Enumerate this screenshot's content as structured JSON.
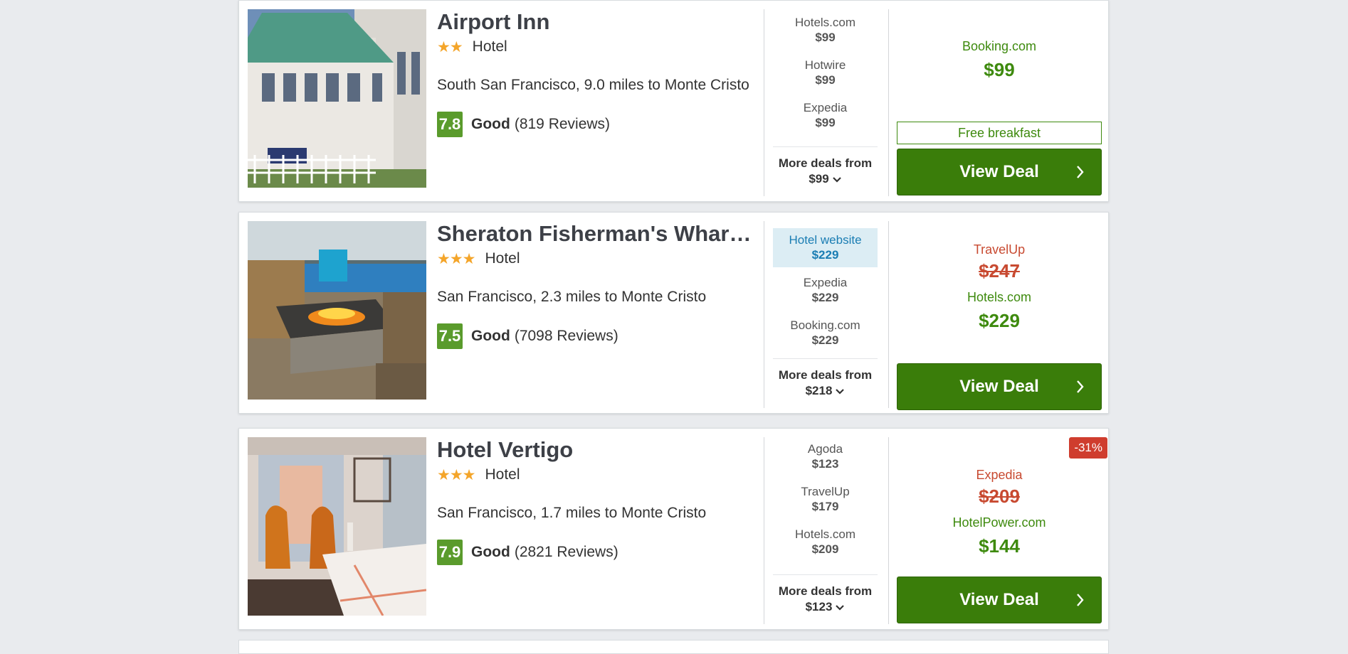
{
  "results": [
    {
      "name": "Airport Inn",
      "stars": "★★",
      "type": "Hotel",
      "location": "South San Francisco, 9.0 miles to Monte Cristo",
      "score": "7.8",
      "rating_word": "Good",
      "reviews": "(819 Reviews)",
      "deals": [
        {
          "provider": "Hotels.com",
          "price": "$99"
        },
        {
          "provider": "Hotwire",
          "price": "$99"
        },
        {
          "provider": "Expedia",
          "price": "$99"
        }
      ],
      "more_label": "More deals from",
      "more_price": "$99",
      "main_provider": "Booking.com",
      "main_price": "$99",
      "perk": "Free breakfast",
      "button": "View Deal"
    },
    {
      "name": "Sheraton Fisherman's Wharf …",
      "stars": "★★★",
      "type": "Hotel",
      "location": "San Francisco, 2.3 miles to Monte Cristo",
      "score": "7.5",
      "rating_word": "Good",
      "reviews": "(7098 Reviews)",
      "deals": [
        {
          "provider": "Hotel website",
          "price": "$229",
          "highlight": true
        },
        {
          "provider": "Expedia",
          "price": "$229"
        },
        {
          "provider": "Booking.com",
          "price": "$229"
        }
      ],
      "more_label": "More deals from",
      "more_price": "$218",
      "old_provider": "TravelUp",
      "old_price": "$247",
      "main_provider": "Hotels.com",
      "main_price": "$229",
      "button": "View Deal"
    },
    {
      "name": "Hotel Vertigo",
      "stars": "★★★",
      "type": "Hotel",
      "location": "San Francisco, 1.7 miles to Monte Cristo",
      "score": "7.9",
      "rating_word": "Good",
      "reviews": "(2821 Reviews)",
      "deals": [
        {
          "provider": "Agoda",
          "price": "$123"
        },
        {
          "provider": "TravelUp",
          "price": "$179"
        },
        {
          "provider": "Hotels.com",
          "price": "$209"
        }
      ],
      "more_label": "More deals from",
      "more_price": "$123",
      "badge": "-31%",
      "old_provider": "Expedia",
      "old_price": "$209",
      "main_provider": "HotelPower.com",
      "main_price": "$144",
      "button": "View Deal"
    }
  ],
  "colors": {
    "accent_green": "#3a7d0a",
    "score_green": "#5a9b2c",
    "star": "#f4a52a",
    "discount_red": "#cf3d2e",
    "highlight_blue": "#1a7db3"
  }
}
